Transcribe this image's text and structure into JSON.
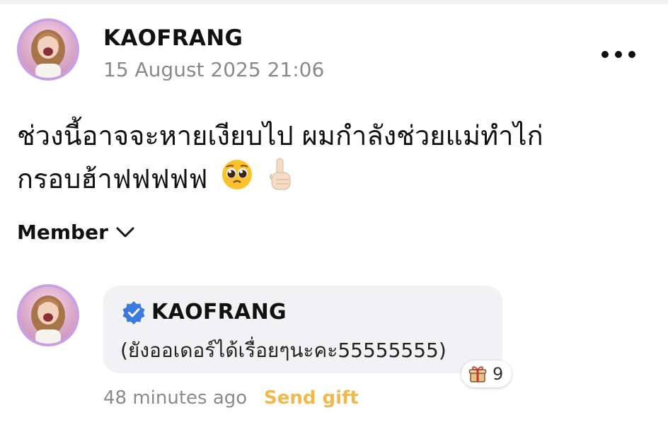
{
  "post": {
    "author": "KAOFRANG",
    "timestamp": "15 August 2025 21:06",
    "body_line1": "ช่วงนี้อาจจะหายเงียบไป ผมกำลังช่วยแม่ทำไก่",
    "body_line2": "กรอบฮ้าฟฟฟฟฟ",
    "emojis": [
      "pleading-face",
      "index-pointing-up-light-skin"
    ],
    "more_icon": "more-horizontal-icon"
  },
  "member_filter": {
    "label": "Member",
    "icon": "chevron-down-icon"
  },
  "comment": {
    "author": "KAOFRANG",
    "verified_icon": "verified-badge-icon",
    "text": "(ยังออเดอร์ได้เรื่อยๆนะคะ55555555)",
    "time": "48 minutes ago",
    "send_gift_label": "Send gift",
    "gift_count": "9",
    "gift_icon": "gift-icon"
  },
  "colors": {
    "avatar_ring": "#c9a0e6",
    "verified_blue": "#3b7be0",
    "send_gift": "#f2b84b",
    "muted_text": "#8a8a8e",
    "bubble_bg": "#f2f2f5"
  }
}
